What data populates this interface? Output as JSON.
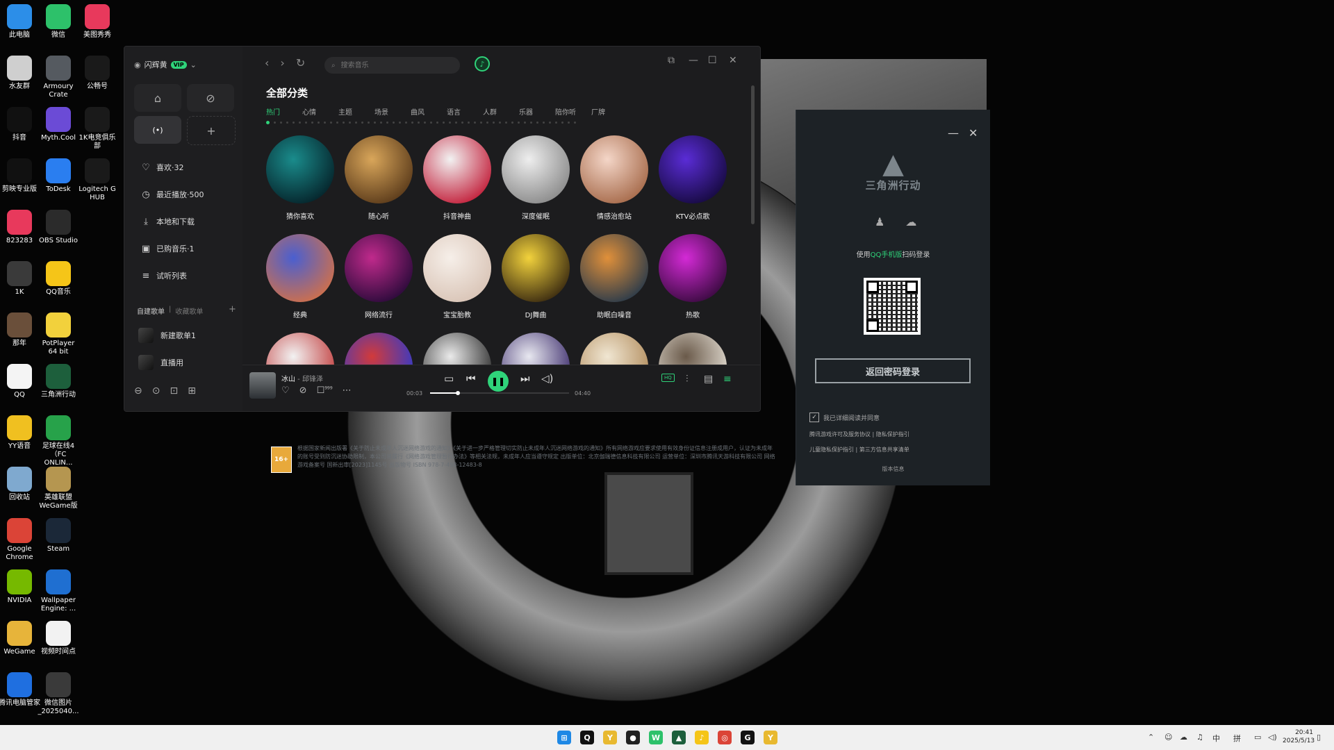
{
  "colors": {
    "accent": "#2fd37a",
    "app_bg": "#1c1c1e",
    "launcher_bg": "#1d2226"
  },
  "desktop": {
    "icons": [
      {
        "label": "此电脑",
        "icon": "computer-icon",
        "color": "#2c8ee8"
      },
      {
        "label": "微信",
        "icon": "wechat-icon",
        "color": "#2dc16a"
      },
      {
        "label": "美图秀秀",
        "icon": "meitu-icon",
        "color": "#e8395c"
      },
      {
        "label": "水友群",
        "icon": "document-icon",
        "color": "#cfcfcf"
      },
      {
        "label": "Armoury Crate",
        "icon": "armoury-crate-icon",
        "color": "#555a60"
      },
      {
        "label": "公畅号",
        "icon": "file-icon",
        "color": "#1a1a1a"
      },
      {
        "label": "抖音",
        "icon": "tiktok-icon",
        "color": "#111111"
      },
      {
        "label": "Myth.Cool",
        "icon": "mythcool-icon",
        "color": "#6b4bd6"
      },
      {
        "label": "1K电竞俱乐部",
        "icon": "file-icon",
        "color": "#1a1a1a"
      },
      {
        "label": "剪映专业版",
        "icon": "capcut-icon",
        "color": "#111111"
      },
      {
        "label": "ToDesk",
        "icon": "todesk-icon",
        "color": "#2a7ef0"
      },
      {
        "label": "Logitech G HUB",
        "icon": "logitech-icon",
        "color": "#1a1a1a"
      },
      {
        "label": "823283",
        "icon": "meitu-icon",
        "color": "#e8395c"
      },
      {
        "label": "OBS Studio",
        "icon": "obs-icon",
        "color": "#2b2b2b"
      },
      {
        "label": "1K",
        "icon": "1k-icon",
        "color": "#3a3a3a"
      },
      {
        "label": "QQ音乐",
        "icon": "qqmusic-icon",
        "color": "#f5c518"
      },
      {
        "label": "那年",
        "icon": "photo-icon",
        "color": "#6a4f3a"
      },
      {
        "label": "PotPlayer 64 bit",
        "icon": "potplayer-icon",
        "color": "#f2d13c"
      },
      {
        "label": "QQ",
        "icon": "qq-icon",
        "color": "#f4f4f4"
      },
      {
        "label": "三角洲行动",
        "icon": "delta-force-icon",
        "color": "#1d5f3c"
      },
      {
        "label": "YY语音",
        "icon": "yy-icon",
        "color": "#f0c020"
      },
      {
        "label": "足球在线4（FC ONLIN...",
        "icon": "fc-online-icon",
        "color": "#27a24a"
      },
      {
        "label": "回收站",
        "icon": "recycle-bin-icon",
        "color": "#7fa9cf"
      },
      {
        "label": "英雄联盟WeGame版",
        "icon": "lol-icon",
        "color": "#b59650"
      },
      {
        "label": "Google Chrome",
        "icon": "chrome-icon",
        "color": "#db4437"
      },
      {
        "label": "Steam",
        "icon": "steam-icon",
        "color": "#1b2838"
      },
      {
        "label": "NVIDIA",
        "icon": "nvidia-icon",
        "color": "#76b900"
      },
      {
        "label": "Wallpaper Engine: ...",
        "icon": "wallpaper-engine-icon",
        "color": "#1f6fd1"
      },
      {
        "label": "WeGame",
        "icon": "wegame-icon",
        "color": "#e7b43a"
      },
      {
        "label": "视频时间点",
        "icon": "text-file-icon",
        "color": "#f2f2f2"
      },
      {
        "label": "腾讯电脑管家",
        "icon": "pc-manager-icon",
        "color": "#1f6fe0"
      },
      {
        "label": "微信图片_2025040...",
        "icon": "1k-icon",
        "color": "#3a3a3a"
      }
    ]
  },
  "music_app": {
    "profile": {
      "name": "闪辉黄",
      "vip": "VIP"
    },
    "sidebar_items": [
      {
        "label": "喜欢·32",
        "icon": "heart-icon"
      },
      {
        "label": "最近播放·500",
        "icon": "clock-icon"
      },
      {
        "label": "本地和下载",
        "icon": "download-icon"
      },
      {
        "label": "已购音乐·1",
        "icon": "purchased-icon"
      },
      {
        "label": "试听列表",
        "icon": "queue-icon"
      }
    ],
    "playlist_tabs": {
      "created": "自建歌单",
      "separator": "|",
      "collected": "收藏歌单"
    },
    "playlists": [
      {
        "label": "新建歌单1"
      },
      {
        "label": "直播用"
      }
    ],
    "search": {
      "placeholder": "搜索音乐"
    },
    "page_title": "全部分类",
    "category_tabs": [
      "热门",
      "心情",
      "主题",
      "场景",
      "曲风",
      "语言",
      "人群",
      "乐器",
      "陪你听",
      "厂牌"
    ],
    "categories": [
      {
        "label": "猜你喜欢",
        "c1": "#1a8c8c",
        "c2": "#05232a"
      },
      {
        "label": "随心听",
        "c1": "#d9a65a",
        "c2": "#5a3a1a"
      },
      {
        "label": "抖音神曲",
        "c1": "#f2f2f2",
        "c2": "#c21f3a"
      },
      {
        "label": "深度催眠",
        "c1": "#eeeeee",
        "c2": "#8a8a8a"
      },
      {
        "label": "情感治愈站",
        "c1": "#f4d6c8",
        "c2": "#a66a4a"
      },
      {
        "label": "KTV必点歌",
        "c1": "#5a2cd6",
        "c2": "#160a40"
      },
      {
        "label": "经典",
        "c1": "#4a5fd0",
        "c2": "#d0704a"
      },
      {
        "label": "网络流行",
        "c1": "#c02a8c",
        "c2": "#2a0a3a"
      },
      {
        "label": "宝宝胎教",
        "c1": "#f6efe9",
        "c2": "#d9c4b6"
      },
      {
        "label": "DJ舞曲",
        "c1": "#f2d23c",
        "c2": "#3a2a10"
      },
      {
        "label": "助眠白噪音",
        "c1": "#e0903a",
        "c2": "#2a3a4a"
      },
      {
        "label": "热歌",
        "c1": "#d42ad6",
        "c2": "#3a0a40"
      },
      {
        "label": "",
        "c1": "#f2f2f2",
        "c2": "#c03a3a"
      },
      {
        "label": "",
        "c1": "#d23a3a",
        "c2": "#2a3ad0"
      },
      {
        "label": "",
        "c1": "#eaeaea",
        "c2": "#2a2a2a"
      },
      {
        "label": "",
        "c1": "#e8e8f0",
        "c2": "#3a2a6a"
      },
      {
        "label": "",
        "c1": "#f0e6d2",
        "c2": "#b08a5a"
      },
      {
        "label": "",
        "c1": "#6a5a4a",
        "c2": "#e6e0d6"
      }
    ],
    "player": {
      "title": "冰山",
      "separator": " - ",
      "artist": "邱锋泽",
      "comment_count": "999",
      "current_time": "00:03",
      "total_time": "04:40",
      "progress": 0.2,
      "quality": "HQ"
    }
  },
  "launcher": {
    "game_name": "三角洲行动",
    "scan_hint_pre": "使用",
    "scan_hint_app": "QQ手机版",
    "scan_hint_post": "扫码登录",
    "password_login": "返回密码登录",
    "agree_text": "我已详细阅读并同意",
    "links_1": "腾讯游戏许可及服务协议 | 隐私保护指引",
    "links_2": "儿童隐私保护指引 | 第三方信息共享清单",
    "version": "版本信息",
    "rating": "16+",
    "notice": "根据国家新闻出版署《关于防止未成年人沉迷网络游戏的通知》《关于进一步严格管理切实防止未成年人沉迷网络游戏的通知》所有网络游戏应要求使用有效身份证信息注册成用户，认证为未成年的账号受到防沉迷协助限制，本公司将履行《网络游戏管理暂行办法》等相关法规，未成年人应当遵守规定 出版单位：北京伽瑞德信息科技有限公司 运营单位：深圳市腾讯天游科技有限公司 网络游戏备案号 国新出审[2023]1145号 出版物号 ISBN 978-7-498-12483-8"
  },
  "taskbar": {
    "tray": {
      "ime": "中",
      "ime2": "拼"
    },
    "time": "20:41",
    "date": "2025/5/13"
  }
}
